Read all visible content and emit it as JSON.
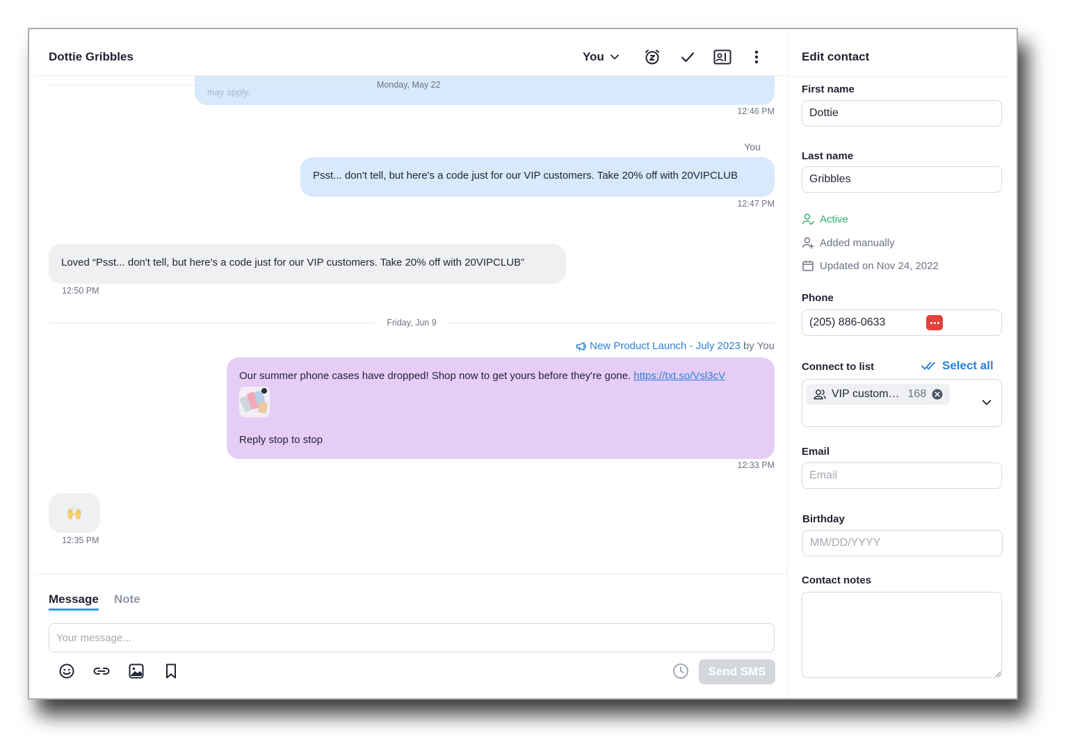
{
  "conversation": {
    "contact_name": "Dottie Gribbles",
    "assignee": "You",
    "header_icons": [
      "snooze-icon",
      "check-icon",
      "contact-card-icon",
      "more-vertical-icon"
    ],
    "cut_text": "may apply.",
    "messages": [
      {
        "type": "outgoing",
        "time": "12:46 PM"
      },
      {
        "type": "outgoing",
        "sender": "You",
        "text": "Psst... don't tell, but here's a code just for our VIP customers. Take 20% off with 20VIPCLUB",
        "time": "12:47 PM"
      },
      {
        "type": "incoming",
        "text": "Loved “Psst... don't tell, but here's a code just for our VIP customers. Take 20% off with 20VIPCLUB”",
        "time": "12:50 PM"
      },
      {
        "type": "campaign",
        "campaign_name": "New Product Launch - July 2023",
        "by_text": "by You",
        "text": "Our summer phone cases have dropped! Shop now to get yours before they're gone.",
        "link": "https://txt.so/Vsl3cV",
        "footer": "Reply stop to stop",
        "time": "12:33 PM"
      },
      {
        "type": "incoming",
        "text": "🙌",
        "time": "12:35 PM"
      }
    ],
    "date_separators": [
      "Monday, May 22",
      "Friday, Jun 9"
    ]
  },
  "composer": {
    "tabs": [
      "Message",
      "Note"
    ],
    "placeholder": "Your message...",
    "send_label": "Send SMS"
  },
  "edit_contact": {
    "title": "Edit contact",
    "first_name_label": "First name",
    "first_name": "Dottie",
    "last_name_label": "Last name",
    "last_name": "Gribbles",
    "status": "Active",
    "source": "Added manually",
    "updated": "Updated on Nov 24, 2022",
    "phone_label": "Phone",
    "phone": "(205) 886-0633",
    "connect_label": "Connect to list",
    "select_all": "Select all",
    "list_chip": "VIP custom…",
    "list_count": "168",
    "email_label": "Email",
    "email_placeholder": "Email",
    "birthday_label": "Birthday",
    "birthday_placeholder": "MM/DD/YYYY",
    "notes_label": "Contact notes"
  },
  "colors": {
    "outgoing_bubble": "#d7e9fb",
    "incoming_bubble": "#eef0f2",
    "campaign_bubble": "#e6cdf6",
    "accent": "#3399d6",
    "active": "#2fae6e"
  }
}
